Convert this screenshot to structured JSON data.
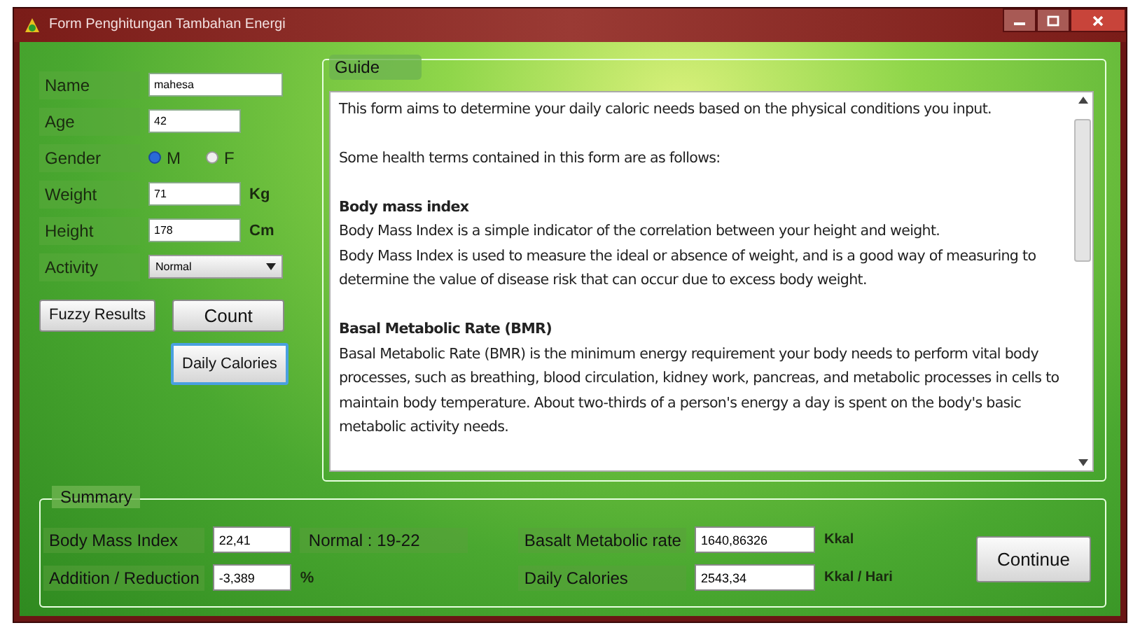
{
  "window": {
    "title": "Form Penghitungan Tambahan Energi"
  },
  "form": {
    "fields": [
      {
        "kind": "text",
        "label": "Name",
        "value": "mahesa"
      },
      {
        "kind": "text",
        "label": "Age",
        "value": "42"
      },
      {
        "kind": "radio",
        "label": "Gender",
        "options": [
          {
            "label": "M",
            "selected": true
          },
          {
            "label": "F",
            "selected": false
          }
        ]
      },
      {
        "kind": "text",
        "label": "Weight",
        "value": "71",
        "unit": "Kg"
      },
      {
        "kind": "text",
        "label": "Height",
        "value": "178",
        "unit": "Cm"
      },
      {
        "kind": "select",
        "label": "Activity",
        "value": "Normal"
      }
    ],
    "buttons": [
      {
        "label": "Fuzzy Results",
        "focused": false
      },
      {
        "label": "Count",
        "focused": false
      },
      {
        "label": "Daily Calories",
        "focused": true
      }
    ]
  },
  "guide": {
    "title": "Guide",
    "blocks": [
      {
        "kind": "text",
        "lines": [
          "This form aims to determine your daily caloric needs based on the physical conditions you input."
        ]
      },
      {
        "kind": "text",
        "lines": [
          "Some health terms contained in this form are as follows:"
        ]
      },
      {
        "kind": "section",
        "heading": "Body mass index",
        "lines": [
          "Body Mass Index is a simple indicator of the correlation between your height and weight.",
          "Body Mass Index is used to measure the ideal or absence of weight, and is a good way of measuring to determine the value of disease risk that can occur due to excess body weight."
        ]
      },
      {
        "kind": "section",
        "heading": "Basal Metabolic Rate (BMR)",
        "lines": [
          "Basal Metabolic Rate (BMR) is the minimum energy requirement your body needs to perform vital body processes, such as breathing, blood circulation, kidney work, pancreas, and metabolic processes in cells to maintain body temperature. About two-thirds of a person's energy a day is spent on the body's basic metabolic activity needs."
        ]
      }
    ]
  },
  "summary": {
    "title": "Summary",
    "body_mass_index": {
      "label": "Body Mass Index",
      "value": "22,41",
      "note": "Normal : 19-22"
    },
    "addition_reduction": {
      "label": "Addition / Reduction",
      "value": "-3,389",
      "unit": "%"
    },
    "basal_metabolic_rate": {
      "label": "Basalt Metabolic rate",
      "value": "1640,86326",
      "unit": "Kkal"
    },
    "daily_calories": {
      "label": "Daily Calories",
      "value": "2543,34",
      "unit": "Kkal / Hari"
    },
    "button": "Continue"
  }
}
